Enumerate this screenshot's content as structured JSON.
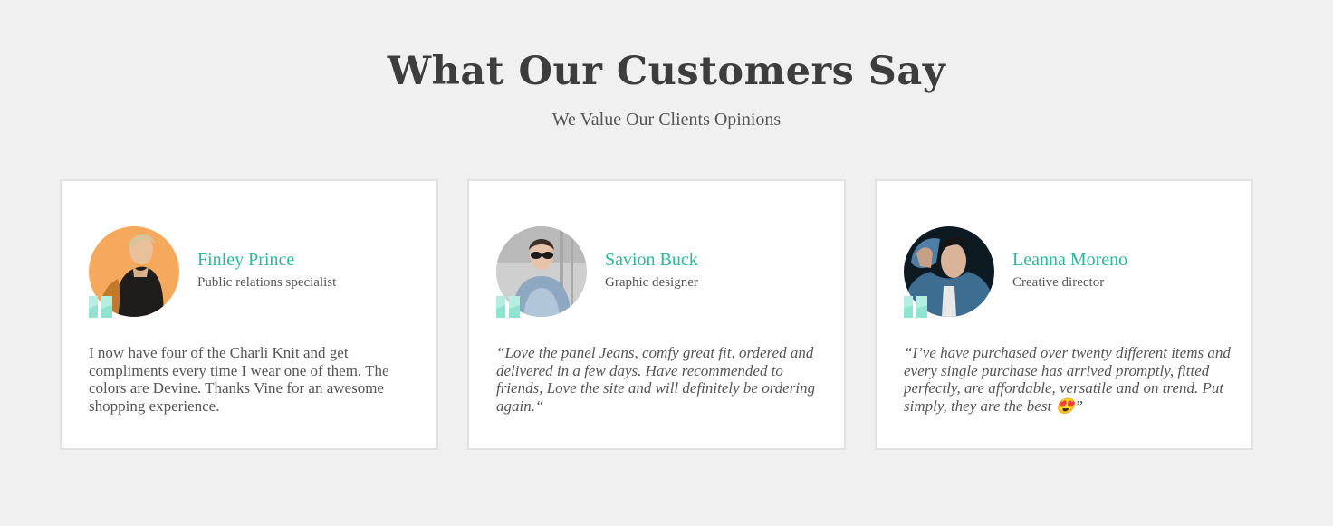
{
  "section": {
    "title": "What Our Customers Say",
    "subtitle": "We Value Our Clients Opinions"
  },
  "accent_color": "#2bb79b",
  "quote_icon_color": "#8fe3d1",
  "testimonials": [
    {
      "name": "Finley Prince",
      "role": "Public relations specialist",
      "review": "I now have four of the Charli Knit and get compliments every time I wear one of them. The colors are Devine. Thanks Vine for an awesome shopping experience.",
      "avatar_icon": "avatar-photo"
    },
    {
      "name": "Savion Buck",
      "role": "Graphic designer",
      "review": "“Love the panel Jeans, comfy great fit, ordered and delivered in a few days. Have recommended to friends, Love the site and will definitely be ordering again.“",
      "avatar_icon": "avatar-photo"
    },
    {
      "name": "Leanna Moreno",
      "role": "Creative director",
      "review": "“I’ve have purchased over twenty different items and every single purchase has arrived promptly, fitted perfectly, are affordable, versatile and on trend. Put simply, they are the best 😍”",
      "avatar_icon": "avatar-photo"
    }
  ]
}
